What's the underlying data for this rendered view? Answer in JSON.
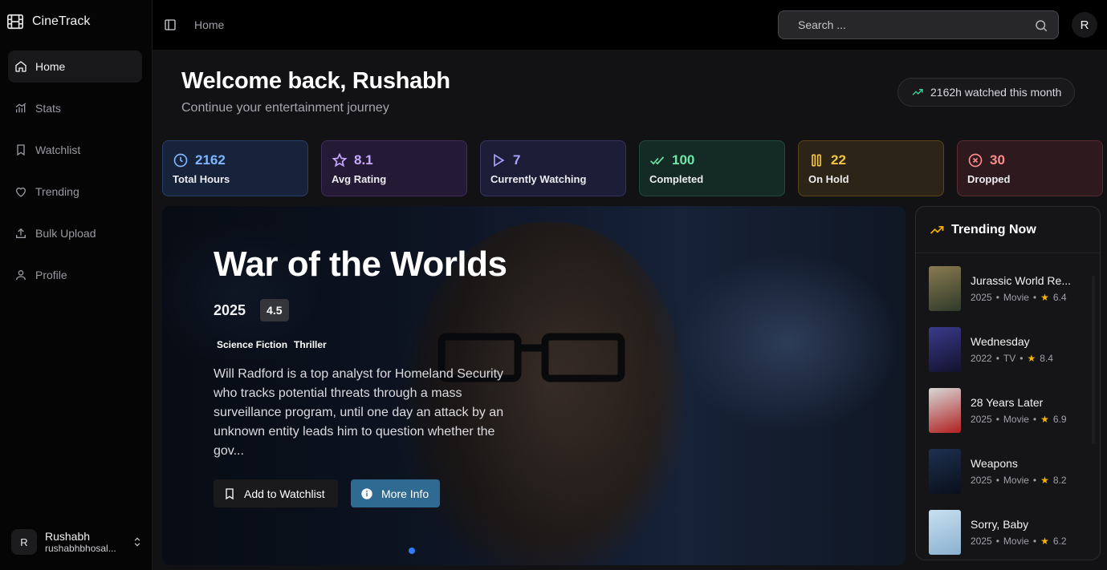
{
  "app": {
    "name": "CineTrack"
  },
  "sidebar": {
    "items": [
      {
        "label": "Home",
        "icon": "home-icon",
        "active": true
      },
      {
        "label": "Stats",
        "icon": "bar-chart-icon"
      },
      {
        "label": "Watchlist",
        "icon": "bookmark-icon"
      },
      {
        "label": "Trending",
        "icon": "heart-icon"
      },
      {
        "label": "Bulk Upload",
        "icon": "upload-icon"
      },
      {
        "label": "Profile",
        "icon": "user-icon"
      }
    ],
    "user": {
      "initial": "R",
      "name": "Rushabh",
      "email": "rushabhbhosal..."
    }
  },
  "header": {
    "breadcrumb": "Home",
    "search": {
      "placeholder": "Search ..."
    },
    "avatar_initial": "R"
  },
  "welcome": {
    "title": "Welcome back, Rushabh",
    "subtitle": "Continue your entertainment journey",
    "badge": "2162h watched this month"
  },
  "stats": [
    {
      "value": "2162",
      "label": "Total Hours",
      "icon": "clock-icon",
      "color": "#7fb4ff",
      "bg": "#17233a",
      "border": "#26406a"
    },
    {
      "value": "8.1",
      "label": "Avg Rating",
      "icon": "star-icon",
      "color": "#c9a8ff",
      "bg": "#241a35",
      "border": "#3d2c5c"
    },
    {
      "value": "7",
      "label": "Currently Watching",
      "icon": "play-icon",
      "color": "#a7a4ff",
      "bg": "#1e1d38",
      "border": "#34325e"
    },
    {
      "value": "100",
      "label": "Completed",
      "icon": "check-double-icon",
      "color": "#6ee7a8",
      "bg": "#142a24",
      "border": "#1f4a3b"
    },
    {
      "value": "22",
      "label": "On Hold",
      "icon": "pause-icon",
      "color": "#f5c542",
      "bg": "#2c2416",
      "border": "#5a4519"
    },
    {
      "value": "30",
      "label": "Dropped",
      "icon": "x-circle-icon",
      "color": "#ff8a8a",
      "bg": "#2e1a1e",
      "border": "#5a2a30"
    }
  ],
  "hero": {
    "title": "War of the Worlds",
    "year": "2025",
    "rating": "4.5",
    "genres": [
      "Science Fiction",
      "Thriller"
    ],
    "description": "Will Radford is a top analyst for Homeland Security who tracks potential threats through a mass surveillance program, until one day an attack by an unknown entity leads him to question whether the gov...",
    "add_label": "Add to Watchlist",
    "info_label": "More Info"
  },
  "trending": {
    "title": "Trending Now",
    "items": [
      {
        "name": "Jurassic World Re...",
        "year": "2025",
        "type": "Movie",
        "rating": "6.4",
        "colors": [
          "#8a7a50",
          "#2e3a2a"
        ]
      },
      {
        "name": "Wednesday",
        "year": "2022",
        "type": "TV",
        "rating": "8.4",
        "colors": [
          "#3a3a8a",
          "#12122e"
        ]
      },
      {
        "name": "28 Years Later",
        "year": "2025",
        "type": "Movie",
        "rating": "6.9",
        "colors": [
          "#d8d8d8",
          "#b02020"
        ]
      },
      {
        "name": "Weapons",
        "year": "2025",
        "type": "Movie",
        "rating": "8.2",
        "colors": [
          "#1c3050",
          "#0a0f1a"
        ]
      },
      {
        "name": "Sorry, Baby",
        "year": "2025",
        "type": "Movie",
        "rating": "6.2",
        "colors": [
          "#c8e0f0",
          "#8ab0d0"
        ]
      }
    ]
  }
}
